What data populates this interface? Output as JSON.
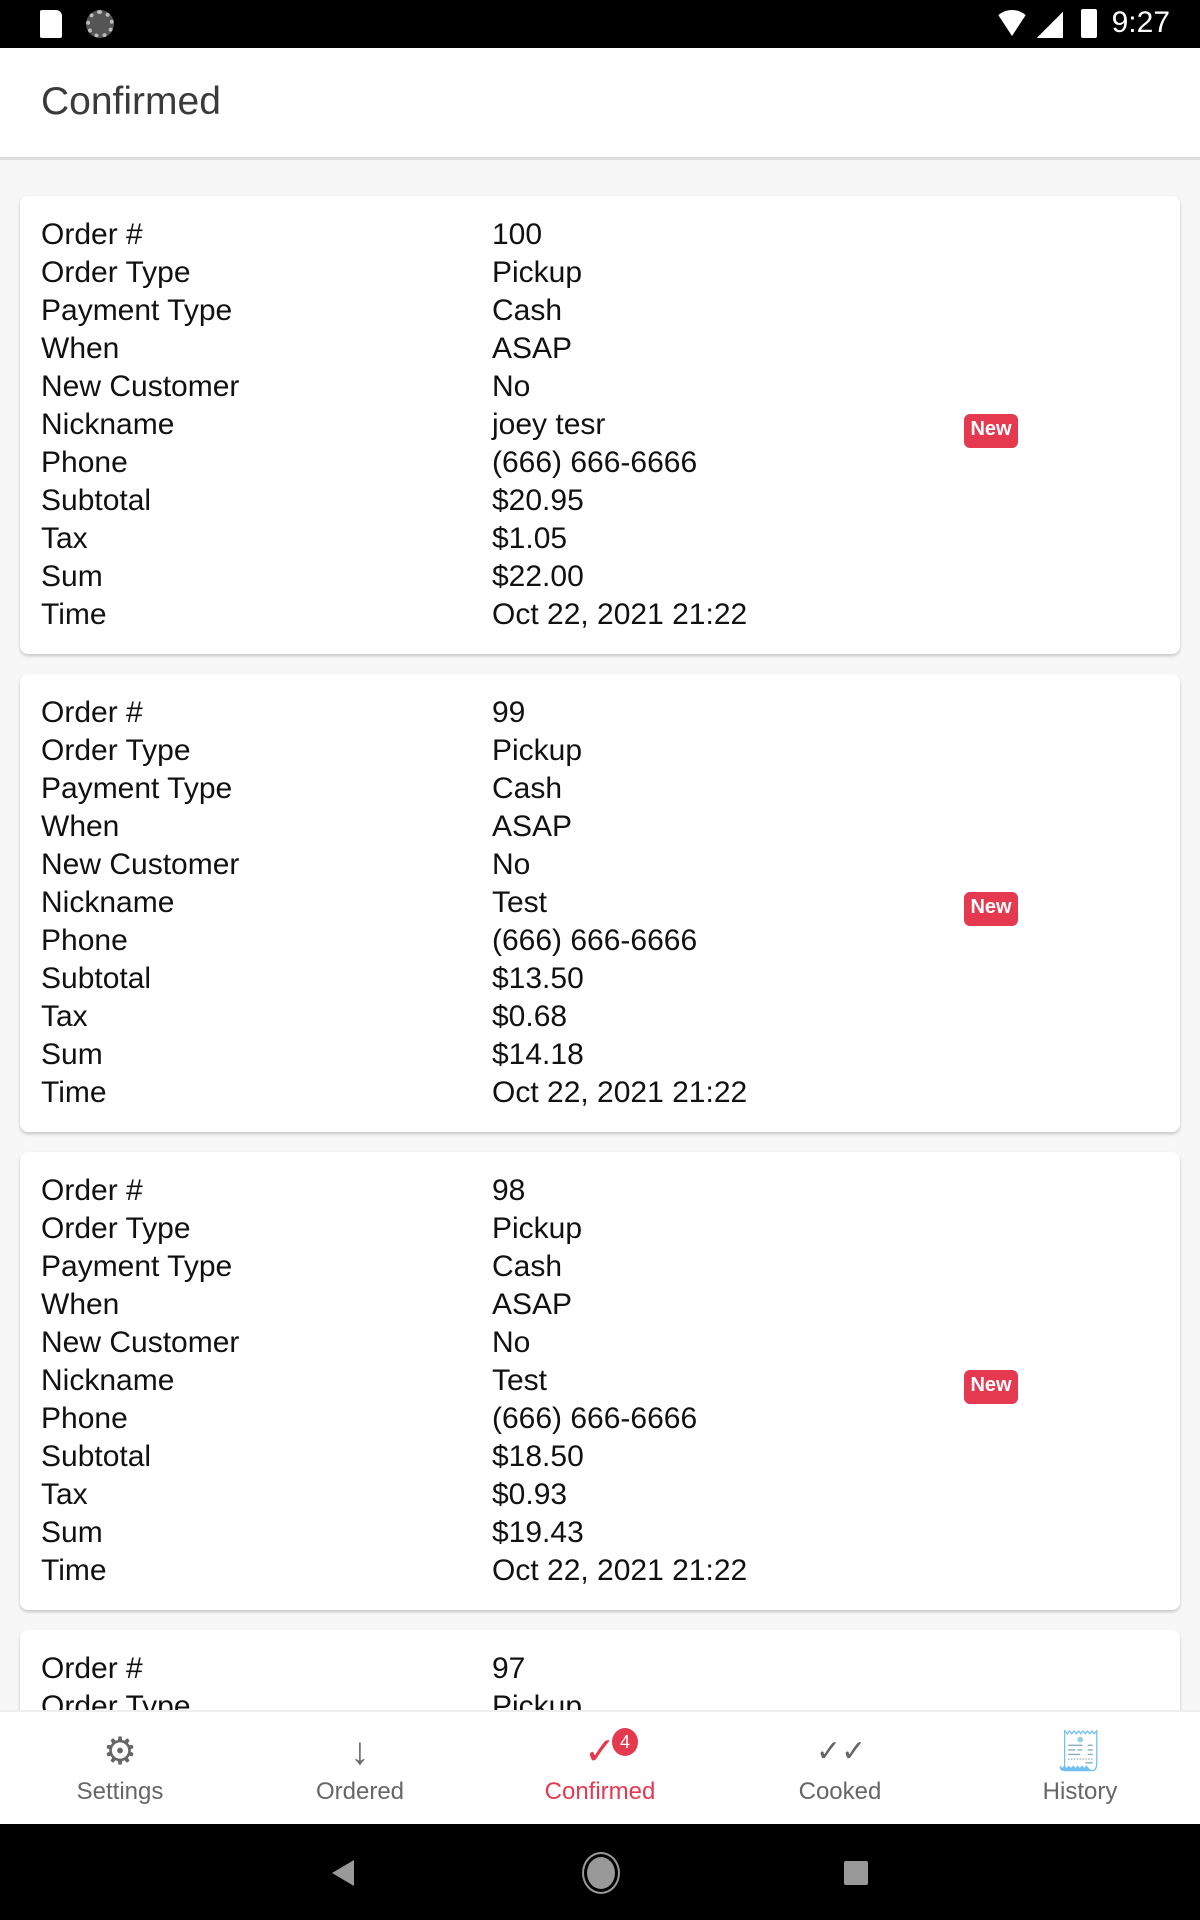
{
  "status_bar": {
    "time": "9:27"
  },
  "header": {
    "title": "Confirmed"
  },
  "labels": [
    "Order #",
    "Order Type",
    "Payment Type",
    "When",
    "New Customer",
    "Nickname",
    "Phone",
    "Subtotal",
    "Tax",
    "Sum",
    "Time"
  ],
  "badge_label": "New",
  "accent": "#e53950",
  "orders": [
    {
      "values": [
        "100",
        "Pickup",
        "Cash",
        "ASAP",
        "No",
        "joey tesr",
        "(666) 666-6666",
        "$20.95",
        "$1.05",
        "$22.00",
        "Oct 22, 2021 21:22"
      ]
    },
    {
      "values": [
        "99",
        "Pickup",
        "Cash",
        "ASAP",
        "No",
        "Test",
        "(666) 666-6666",
        "$13.50",
        "$0.68",
        "$14.18",
        "Oct 22, 2021 21:22"
      ]
    },
    {
      "values": [
        "98",
        "Pickup",
        "Cash",
        "ASAP",
        "No",
        "Test",
        "(666) 666-6666",
        "$18.50",
        "$0.93",
        "$19.43",
        "Oct 22, 2021 21:22"
      ]
    },
    {
      "values": [
        "97",
        "Pickup"
      ]
    }
  ],
  "nav": {
    "tabs": [
      {
        "label": "Settings",
        "icon": "gear-icon"
      },
      {
        "label": "Ordered",
        "icon": "arrow-down-icon"
      },
      {
        "label": "Confirmed",
        "icon": "check-icon",
        "badge": "4",
        "active": true
      },
      {
        "label": "Cooked",
        "icon": "double-check-icon"
      },
      {
        "label": "History",
        "icon": "receipt-icon"
      }
    ]
  }
}
